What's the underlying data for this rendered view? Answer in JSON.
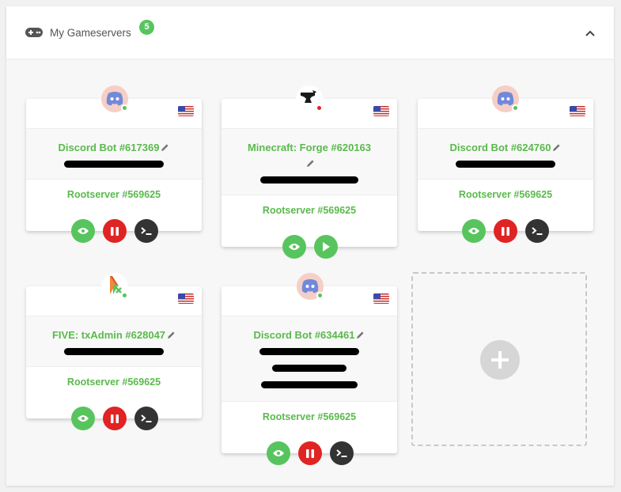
{
  "header": {
    "title": "My Gameservers",
    "count": "5"
  },
  "servers": [
    {
      "name": "Discord Bot #617369",
      "server": "Rootserver #569625",
      "status": "online"
    },
    {
      "name": "Minecraft: Forge #620163",
      "server": "Rootserver #569625",
      "status": "offline"
    },
    {
      "name": "Discord Bot #624760",
      "server": "Rootserver #569625",
      "status": "online"
    },
    {
      "name": "FIVE: txAdmin #628047",
      "server": "Rootserver #569625",
      "status": "online"
    },
    {
      "name": "Discord Bot #634461",
      "server": "Rootserver #569625",
      "status": "online"
    }
  ],
  "icons": {
    "collapse": "chevron-up-icon",
    "gamepad": "gamepad-icon",
    "view": "eye-icon",
    "stop": "pause-icon",
    "start": "play-icon",
    "console": "terminal-icon",
    "add": "plus-icon",
    "edit": "pencil-icon",
    "flag": "us-flag-icon"
  },
  "colors": {
    "accent": "#58c45e",
    "link": "#5ab94c",
    "danger": "#e02424",
    "dark": "#333333",
    "discord_bg": "#f5cfc6"
  }
}
